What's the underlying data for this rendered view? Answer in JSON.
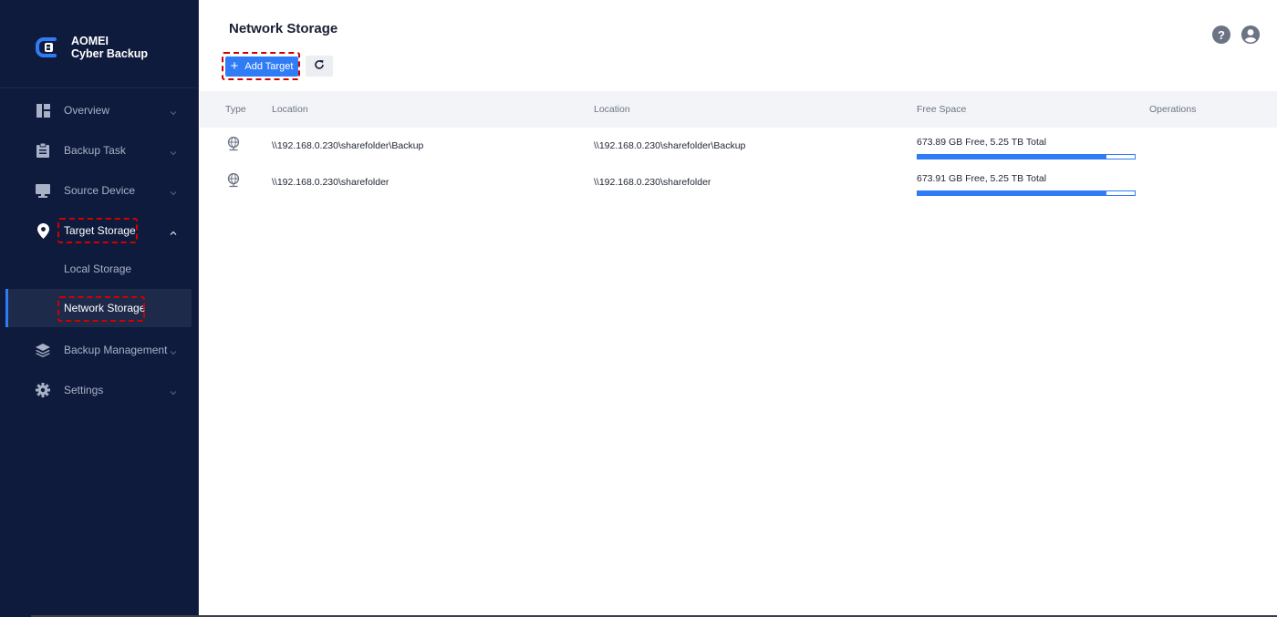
{
  "app": {
    "brand_line1": "AOMEI",
    "brand_line2": "Cyber Backup"
  },
  "colors": {
    "sidebar_bg": "#0f1b3d",
    "accent": "#2f7cf6",
    "highlight": "#d10000"
  },
  "sidebar": {
    "items": [
      {
        "label": "Overview",
        "icon": "dashboard-icon"
      },
      {
        "label": "Backup Task",
        "icon": "clipboard-icon"
      },
      {
        "label": "Source Device",
        "icon": "monitor-icon"
      },
      {
        "label": "Target Storage",
        "icon": "location-pin-icon",
        "expanded": true
      },
      {
        "label": "Backup Management",
        "icon": "layers-icon"
      },
      {
        "label": "Settings",
        "icon": "gear-icon"
      }
    ],
    "subitems": [
      {
        "label": "Local Storage"
      },
      {
        "label": "Network Storage",
        "selected": true
      }
    ]
  },
  "main": {
    "title": "Network Storage",
    "add_button": "Add Target",
    "columns": [
      "Type",
      "Location",
      "Location",
      "Free Space",
      "Operations"
    ],
    "rows": [
      {
        "type_icon": "network-globe-icon",
        "location1": "\\\\192.168.0.230\\sharefolder\\Backup",
        "location2": "\\\\192.168.0.230\\sharefolder\\Backup",
        "free_space": "673.89 GB Free, 5.25 TB Total",
        "used_fraction": 0.87
      },
      {
        "type_icon": "network-globe-icon",
        "location1": "\\\\192.168.0.230\\sharefolder",
        "location2": "\\\\192.168.0.230\\sharefolder",
        "free_space": "673.91 GB Free, 5.25 TB Total",
        "used_fraction": 0.87
      }
    ]
  }
}
